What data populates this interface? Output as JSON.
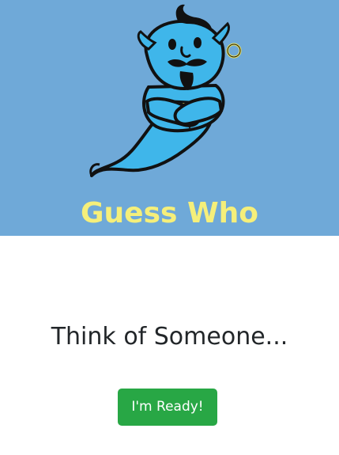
{
  "app": {
    "title": "Guess Who",
    "logo_icon": "genie-icon"
  },
  "main": {
    "prompt": "Think of Someone...",
    "ready_label": "I'm Ready!"
  },
  "colors": {
    "hero_background": "#6fa9d8",
    "title_color": "#f5ef7a",
    "button_color": "#28a745"
  }
}
